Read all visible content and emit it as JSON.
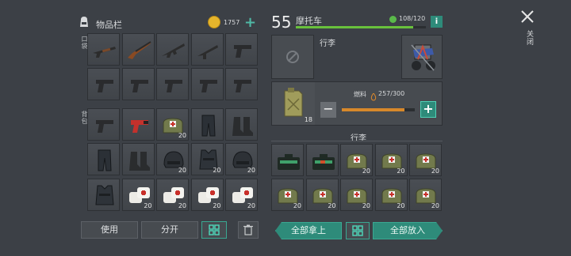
{
  "inventory": {
    "title": "物品栏",
    "coins": "1757",
    "add_coins": "+",
    "section_quick": "口袋",
    "section_backpack": "背包",
    "slots": [
      {
        "icon": "shotgun-icon",
        "qty": ""
      },
      {
        "icon": "rifle-icon",
        "qty": ""
      },
      {
        "icon": "assault-rifle-icon",
        "qty": ""
      },
      {
        "icon": "smg-icon",
        "qty": ""
      },
      {
        "icon": "pistol-icon",
        "qty": ""
      },
      {
        "icon": "pistol-icon",
        "qty": ""
      },
      {
        "icon": "pistol-icon",
        "qty": ""
      },
      {
        "icon": "pistol-icon",
        "qty": ""
      },
      {
        "icon": "pistol-icon",
        "qty": ""
      },
      {
        "icon": "pistol-icon",
        "qty": ""
      },
      {
        "icon": "pistol-icon",
        "qty": ""
      },
      {
        "icon": "flare-gun-icon",
        "qty": ""
      },
      {
        "icon": "medkit-bag-icon",
        "qty": "20"
      },
      {
        "icon": "armored-pants-icon",
        "qty": ""
      },
      {
        "icon": "boots-icon",
        "qty": ""
      },
      {
        "icon": "armored-pants-icon",
        "qty": ""
      },
      {
        "icon": "boots-icon",
        "qty": ""
      },
      {
        "icon": "helmet-icon",
        "qty": "20"
      },
      {
        "icon": "armor-vest-icon",
        "qty": "20"
      },
      {
        "icon": "helmet-icon",
        "qty": "20"
      },
      {
        "icon": "armor-vest-icon",
        "qty": ""
      },
      {
        "icon": "bandage-icon",
        "qty": "20"
      },
      {
        "icon": "bandage-icon",
        "qty": "20"
      },
      {
        "icon": "bandage-icon",
        "qty": "20"
      },
      {
        "icon": "bandage-icon",
        "qty": "20"
      }
    ],
    "use_label": "使用",
    "split_label": "分开"
  },
  "vehicle": {
    "level": "55",
    "name": "摩托车",
    "durability": "108/120",
    "durability_fraction": 0.9,
    "info": "i",
    "cargo_label": "行李",
    "fuel_label": "燃料",
    "fuel_value": "257/300",
    "fuel_fraction": 0.857,
    "fuel_can_qty": "18",
    "minus": "−",
    "plus": "+",
    "storage_title": "行李",
    "storage_slots": [
      {
        "icon": "tool-case-icon",
        "qty": ""
      },
      {
        "icon": "tool-case-red-icon",
        "qty": ""
      },
      {
        "icon": "medkit-bag-icon",
        "qty": "20"
      },
      {
        "icon": "medkit-bag-icon",
        "qty": "20"
      },
      {
        "icon": "medkit-bag-icon",
        "qty": "20"
      },
      {
        "icon": "medkit-bag-icon",
        "qty": "20"
      },
      {
        "icon": "medkit-bag-icon",
        "qty": "20"
      },
      {
        "icon": "medkit-bag-icon",
        "qty": "20"
      },
      {
        "icon": "medkit-bag-icon",
        "qty": "20"
      },
      {
        "icon": "medkit-bag-icon",
        "qty": "20"
      }
    ],
    "take_all": "全部拿上",
    "put_all": "全部放入"
  },
  "close_label": "关闭"
}
